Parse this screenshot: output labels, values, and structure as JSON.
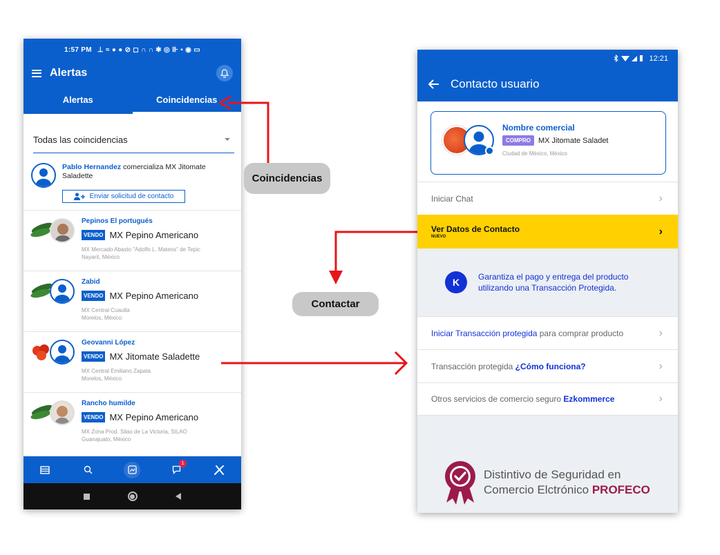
{
  "left_phone": {
    "status_time": "1:57 PM",
    "status_icons": "⊥ ≈ ● ● ⊘ ◻ ∩   ∩ ✱ ◎ ⊪ ▪ ◉ ▭",
    "title": "Alertas",
    "tabs": [
      "Alertas",
      "Coincidencias"
    ],
    "filter_value": "Todas las coincidencias",
    "first_item": {
      "name": "Pablo Hernandez",
      "text": " comercializa MX Jitomate Saladette",
      "button": "Enviar solicitud de contacto"
    },
    "items": [
      {
        "seller": "Pepinos El portugués",
        "badge": "VENDO",
        "product": "MX Pepino Americano",
        "location_line1": "MX Mercado Abasto \"Adolfo L. Mateos\" de Tepic",
        "location_line2": "Nayarit, México"
      },
      {
        "seller": "Zabid",
        "badge": "VENDO",
        "product": "MX Pepino Americano",
        "location_line1": "MX Central Cuautla",
        "location_line2": "Morelos, México"
      },
      {
        "seller": "Geovanni López",
        "badge": "VENDO",
        "product": "MX Jitomate Saladette",
        "location_line1": "MX Central Emiliano Zapata",
        "location_line2": "Morelos, México"
      },
      {
        "seller": "Rancho humilde",
        "badge": "VENDO",
        "product": "MX Pepino Americano",
        "location_line1": "MX Zona Prod. Silao de La Victoria, SILAO",
        "location_line2": "Guanajuato, México"
      }
    ],
    "notification_count": "1"
  },
  "annotations": {
    "coincidencias": "Coincidencias",
    "contactar": "Contactar"
  },
  "right_phone": {
    "status_time": "12:21",
    "title": "Contacto usuario",
    "card": {
      "title": "Nombre comercial",
      "badge": "COMPRO",
      "product": "MX Jitomate Saladet",
      "location": "Ciudad de México, México"
    },
    "row_chat": "Iniciar Chat",
    "row_contact": "Ver Datos de Contacto",
    "row_contact_tag": "NUEVO",
    "promo_text": "Garantiza el pago y entrega del producto utilizando una Transacción Protegida.",
    "promo_logo": "K",
    "row_transaccion_link": "Iniciar Transacción protegida",
    "row_transaccion_rest": " para comprar producto",
    "row_como_prefix": "Transacción protegida ",
    "row_como_link": "¿Cómo funciona?",
    "row_otros_prefix": "Otros servicios de comercio seguro ",
    "row_otros_link": "Ezkommerce",
    "profeco_line1": "Distintivo de Seguridad en",
    "profeco_line2": "Comercio Elctrónico ",
    "profeco_brand": "PROFECO"
  },
  "colors": {
    "primary": "#0b5fcc",
    "yellow": "#ffd100",
    "arrow": "#e8141b",
    "profeco": "#9b1b4a"
  }
}
